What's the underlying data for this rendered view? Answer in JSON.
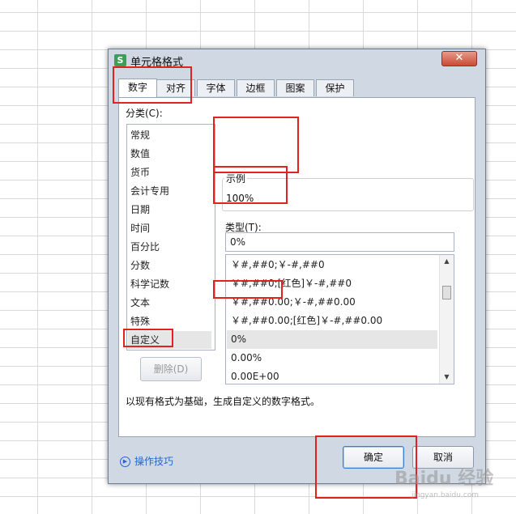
{
  "dialog": {
    "title": "单元格格式",
    "app_icon": "S",
    "close_label": "✕"
  },
  "tabs": [
    {
      "label": "数字",
      "active": true
    },
    {
      "label": "对齐",
      "active": false
    },
    {
      "label": "字体",
      "active": false
    },
    {
      "label": "边框",
      "active": false
    },
    {
      "label": "图案",
      "active": false
    },
    {
      "label": "保护",
      "active": false
    }
  ],
  "category": {
    "label": "分类(C):",
    "items": [
      "常规",
      "数值",
      "货币",
      "会计专用",
      "日期",
      "时间",
      "百分比",
      "分数",
      "科学记数",
      "文本",
      "特殊",
      "自定义"
    ],
    "selected": "自定义"
  },
  "sample": {
    "label": "示例",
    "value": "100%"
  },
  "type": {
    "label": "类型(T):",
    "value": "0%",
    "formats": [
      "￥#,##0;￥-#,##0",
      "￥#,##0;[红色]￥-#,##0",
      "￥#,##0.00;￥-#,##0.00",
      "￥#,##0.00;[红色]￥-#,##0.00",
      "0%",
      "0.00%",
      "0.00E+00"
    ],
    "selected": "0%"
  },
  "delete_button": "删除(D)",
  "description": "以现有格式为基础，生成自定义的数字格式。",
  "tips_link": "操作技巧",
  "ok_button": "确定",
  "cancel_button": "取消",
  "watermark": {
    "text": "Baidu 经验",
    "sub": "jingyan.baidu.com"
  },
  "colors": {
    "annotation": "#e2221c",
    "dialog_bg": "#cfd8e3",
    "link": "#2a67c4",
    "selection": "#e6e6e6"
  }
}
